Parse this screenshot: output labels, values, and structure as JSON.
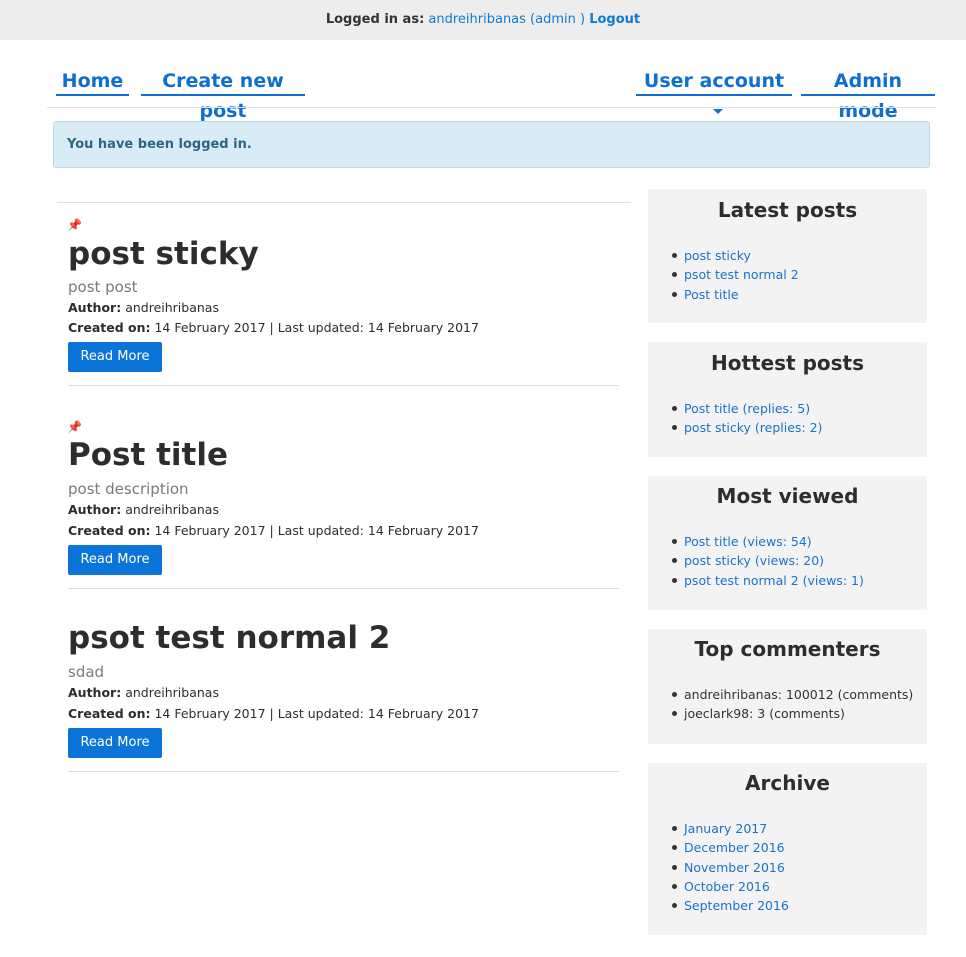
{
  "topbar": {
    "logged_label": "Logged in as:",
    "user": "andreihribanas (admin )",
    "logout": "Logout"
  },
  "nav": {
    "home": "Home",
    "create": "Create new post",
    "user_account": "User account",
    "admin_mode": "Admin mode"
  },
  "alert": {
    "text": "You have been logged in."
  },
  "posts": [
    {
      "pinned": true,
      "title": "post sticky",
      "description": "post post",
      "author_label": "Author:",
      "author": "andreihribanas",
      "created_label": "Created on:",
      "dates": "14 February 2017 | Last updated: 14 February 2017",
      "button": "Read More"
    },
    {
      "pinned": true,
      "title": "Post title",
      "description": "post description",
      "author_label": "Author:",
      "author": "andreihribanas",
      "created_label": "Created on:",
      "dates": "14 February 2017 | Last updated: 14 February 2017",
      "button": "Read More"
    },
    {
      "pinned": false,
      "title": "psot test normal 2",
      "description": "sdad",
      "author_label": "Author:",
      "author": "andreihribanas",
      "created_label": "Created on:",
      "dates": "14 February 2017 | Last updated: 14 February 2017",
      "button": "Read More"
    }
  ],
  "sidebar": {
    "latest": {
      "title": "Latest posts",
      "items": [
        "post sticky",
        "psot test normal 2",
        "Post title"
      ]
    },
    "hottest": {
      "title": "Hottest posts",
      "items": [
        "Post title (replies: 5)",
        "post sticky (replies: 2)"
      ]
    },
    "viewed": {
      "title": "Most viewed",
      "items": [
        "Post title (views: 54)",
        "post sticky (views: 20)",
        "psot test normal 2 (views: 1)"
      ]
    },
    "commenters": {
      "title": "Top commenters",
      "items": [
        "andreihribanas: 100012 (comments)",
        "joeclark98: 3 (comments)"
      ]
    },
    "archive": {
      "title": "Archive",
      "items": [
        "January 2017",
        "December 2016",
        "November 2016",
        "October 2016",
        "September 2016"
      ]
    }
  },
  "colors": {
    "link": "#1a73c7",
    "button": "#0b74d8",
    "alert_bg": "#d9ecf6"
  }
}
